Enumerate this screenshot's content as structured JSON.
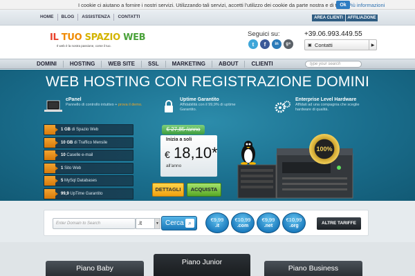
{
  "cookie": {
    "text": "I cookie ci aiutano a fornire i nostri servizi. Utilizzando tali servizi, accetti l'utilizzo dei cookie da parte nostra e di terzi.",
    "more": "Più informazioni",
    "ok": "Ok"
  },
  "topnav": {
    "links": [
      "HOME",
      "BLOG",
      "ASSISTENZA",
      "CONTATTI"
    ],
    "area_clienti": "AREA CLIENTI",
    "affiliazione": "AFFILIAZIONE"
  },
  "header": {
    "logo_text": "IL TUO SPAZIO WEB",
    "tagline": "Il web è la nostra passione, come il tuo.",
    "follow": "Seguici su:",
    "phone": "+39.06.993.449.55",
    "contact_label": "Contatti",
    "social": [
      "t",
      "f",
      "in",
      "g+"
    ]
  },
  "menu": {
    "items": [
      "DOMINI",
      "HOSTING",
      "WEB SITE",
      "SSL",
      "MARKETING",
      "ABOUT",
      "CLIENTI"
    ],
    "search_placeholder": "type your search"
  },
  "hero": {
    "title": "WEB HOSTING CON REGISTRAZIONE DOMINI",
    "features": [
      {
        "title": "cPanel",
        "desc": "Pannello di controllo intuitivo +",
        "highlight": "prova il demo."
      },
      {
        "title": "Uptime Garantito",
        "desc": "Affidabilità con il 99,9% di uptime Garantito."
      },
      {
        "title": "Enterprise Level Hardware",
        "desc": "Affidati ad una compagnia che sceglie hardware di qualità."
      }
    ],
    "plan_features": [
      {
        "bold": "1 GB",
        "text": " di Spazio Web"
      },
      {
        "bold": "10 GB",
        "text": " di Traffico Mensile"
      },
      {
        "bold": "10",
        "text": " Caselle e-mail"
      },
      {
        "bold": "1",
        "text": " Sito Web"
      },
      {
        "bold": "5",
        "text": " MySql Databases"
      },
      {
        "bold": "99,9",
        "text": " UpTime Garantito"
      }
    ],
    "old_price": "€ 27,85 /anno",
    "inizia": "Inizia a soli",
    "currency": "€",
    "price": "18,10*",
    "per_year": "all'anno",
    "details_btn": "DETTAGLI",
    "buy_btn": "ACQUISTA",
    "badge": "100%"
  },
  "domain": {
    "placeholder": "Enter Domain to Search",
    "tld": ".it",
    "search_btn": "Cerca",
    "prices": [
      {
        "price": "€9,99",
        "ext": ".it"
      },
      {
        "price": "€10,99",
        "ext": ".com"
      },
      {
        "price": "€9,99",
        "ext": ".net"
      },
      {
        "price": "€10,99",
        "ext": ".org"
      }
    ],
    "more_btn": "ALTRE TARIFFE"
  },
  "plans": [
    "Piano Baby",
    "Piano Junior",
    "Piano Business"
  ],
  "colors": {
    "accent": "#2d7cc2",
    "hero": "#1a6e8d",
    "orange": "#f0a010",
    "green": "#58a826"
  }
}
